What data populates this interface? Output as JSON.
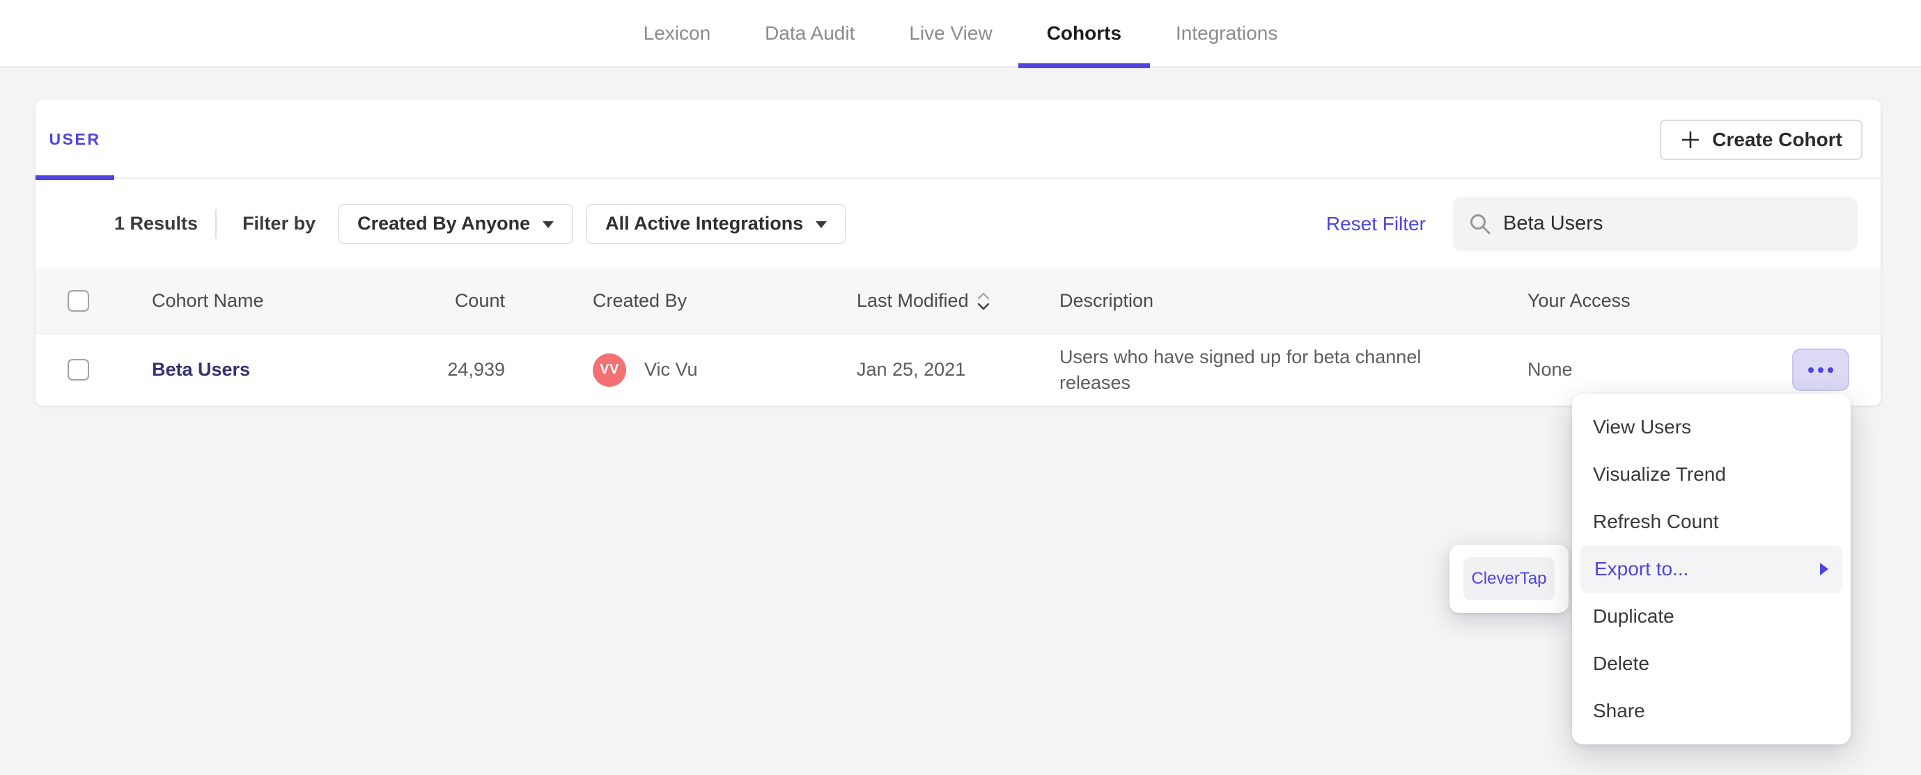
{
  "nav": {
    "tabs": [
      {
        "label": "Lexicon",
        "active": false
      },
      {
        "label": "Data Audit",
        "active": false
      },
      {
        "label": "Live View",
        "active": false
      },
      {
        "label": "Cohorts",
        "active": true
      },
      {
        "label": "Integrations",
        "active": false
      }
    ]
  },
  "cohorts_page": {
    "tab_label": "USER",
    "create_button_label": "Create Cohort",
    "toolbar": {
      "results_count": "1 Results",
      "filter_by_label": "Filter by",
      "created_by_filter": "Created By Anyone",
      "integrations_filter": "All Active Integrations",
      "reset_filter_label": "Reset Filter",
      "search_value": "Beta Users"
    },
    "table": {
      "headers": {
        "name": "Cohort Name",
        "count": "Count",
        "created_by": "Created By",
        "last_modified": "Last Modified",
        "description": "Description",
        "your_access": "Your Access"
      },
      "rows": [
        {
          "name": "Beta Users",
          "count": "24,939",
          "avatar_initials": "VV",
          "created_by": "Vic Vu",
          "last_modified": "Jan 25, 2021",
          "description": "Users who have signed up for beta channel releases",
          "your_access": "None"
        }
      ]
    }
  },
  "context_menu": {
    "items": [
      "View Users",
      "Visualize Trend",
      "Refresh Count",
      "Export to...",
      "Duplicate",
      "Delete",
      "Share"
    ],
    "highlighted_item": "Export to...",
    "submenu": {
      "items": [
        "CleverTap"
      ]
    }
  },
  "icons": {
    "plus": "plus-cross",
    "caret": "caret-down-triangle",
    "search": "magnifier",
    "sort": "up-down-chevrons",
    "more": "three-outlined-circles",
    "submenu_arrow": "right-triangle"
  },
  "colors": {
    "accent_purple": "#4f44e0",
    "avatar_salmon": "#f37173",
    "cohort_link_indigo": "#35316e",
    "page_background": "#f4f4f5",
    "more_button_bg": "#dbd9f4",
    "menu_highlight_bg": "#f4f4f6"
  }
}
